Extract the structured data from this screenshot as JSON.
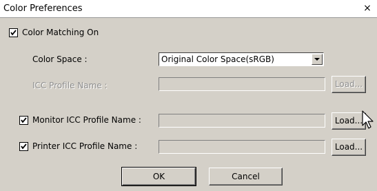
{
  "window": {
    "title": "Color Preferences",
    "close_glyph": "×"
  },
  "color_matching": {
    "label": "Color Matching On",
    "checked": true
  },
  "color_space": {
    "label": "Color Space :",
    "selected": "Original Color Space(sRGB)"
  },
  "icc_profile": {
    "label": "ICC Profile Name :",
    "value": "",
    "load_label": "Load..."
  },
  "monitor_profile": {
    "label": "Monitor ICC Profile Name :",
    "checked": true,
    "value": "",
    "load_label": "Load..."
  },
  "printer_profile": {
    "label": "Printer ICC Profile Name :",
    "checked": true,
    "value": "",
    "load_label": "Load..."
  },
  "buttons": {
    "ok": "OK",
    "cancel": "Cancel"
  },
  "icons": {
    "close": "close-icon",
    "check": "check-icon",
    "dropdown": "chevron-down-icon",
    "cursor": "mouse-pointer-icon"
  }
}
